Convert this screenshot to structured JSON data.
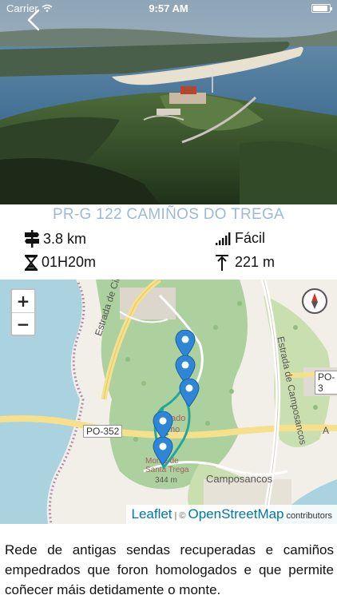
{
  "status_bar": {
    "carrier": "Carrier",
    "time": "9:57 AM",
    "battery_level": 0.9
  },
  "nav": {
    "back_icon": "chevron-left-icon"
  },
  "trail": {
    "title": "PR-G 122 CAMIÑOS DO TREGA",
    "distance": "3.8 km",
    "difficulty": "Fácil",
    "duration": "01H20m",
    "elevation": "221 m"
  },
  "map": {
    "zoom_in": "+",
    "zoom_out": "−",
    "labels": {
      "road_circunvalacion": "Estrada de Circunvalación",
      "road_camposancos": "Estrada de Camposancos",
      "po352": "PO-352",
      "po3": "PO-3",
      "town": "Camposancos",
      "peak_name": "Monte de Santa Trega",
      "peak_height": "344 m",
      "fragment_a": "A",
      "poi_a": "ado",
      "poi_b": "mo"
    },
    "attribution": {
      "leaflet": "Leaflet",
      "copy": "©",
      "osm": "OpenStreetMap",
      "contributors": "contributors"
    },
    "colors": {
      "route": "#26a69a",
      "pin": "#2f86d6",
      "water": "#aad3df",
      "forest": "#add19e",
      "land": "#f2efe9"
    }
  },
  "description": "Rede de antigas sendas recuperadas e camiños empedrados que foron homologados e que permite coñecer máis detidamente o monte."
}
